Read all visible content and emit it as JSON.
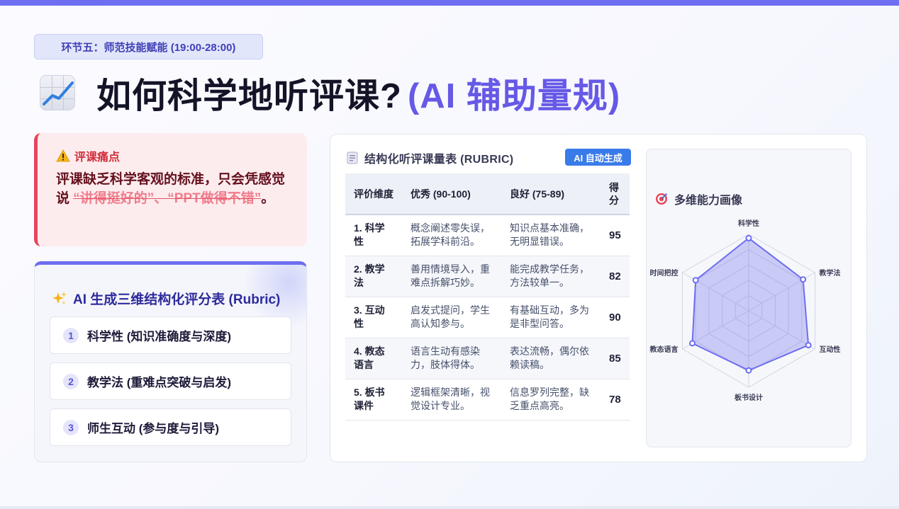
{
  "section_tag": "环节五：师范技能赋能 (19:00-28:00)",
  "title": {
    "main": "如何科学地听评课?",
    "accent": "(AI 辅助量规)",
    "icon": "chart-increasing-icon"
  },
  "pain_point": {
    "heading": "评课痛点",
    "body_prefix": "评课缺乏科学客观的标准，只会凭感觉说",
    "struck_text": "“讲得挺好的”、“PPT做得不错”",
    "body_suffix": "。"
  },
  "rubric_card": {
    "heading": "AI 生成三维结构化评分表 (Rubric)",
    "items": [
      {
        "num": "1",
        "label": "科学性 (知识准确度与深度)"
      },
      {
        "num": "2",
        "label": "教学法 (重难点突破与启发)"
      },
      {
        "num": "3",
        "label": "师生互动 (参与度与引导)"
      }
    ]
  },
  "table": {
    "title": "结构化听评课量表 (RUBRIC)",
    "badge": "AI 自动生成",
    "headers": [
      "评价维度",
      "优秀 (90-100)",
      "良好 (75-89)",
      "得分"
    ],
    "rows": [
      {
        "dim": "1. 科学性",
        "excellent": "概念阐述零失误，拓展学科前沿。",
        "good": "知识点基本准确，无明显错误。",
        "score": "95"
      },
      {
        "dim": "2. 教学法",
        "excellent": "善用情境导入，重难点拆解巧妙。",
        "good": "能完成教学任务，方法较单一。",
        "score": "82"
      },
      {
        "dim": "3. 互动性",
        "excellent": "启发式提问，学生高认知参与。",
        "good": "有基础互动，多为是非型问答。",
        "score": "90"
      },
      {
        "dim": "4. 教态语言",
        "excellent": "语言生动有感染力，肢体得体。",
        "good": "表达流畅，偶尔依赖读稿。",
        "score": "85"
      },
      {
        "dim": "5. 板书课件",
        "excellent": "逻辑框架清晰，视觉设计专业。",
        "good": "信息罗列完整，缺乏重点高亮。",
        "score": "78"
      }
    ]
  },
  "radar": {
    "title": "多维能力画像",
    "accent_color": "#6d6ef0"
  },
  "chart_data": {
    "type": "radar",
    "title": "多维能力画像",
    "axes": [
      "科学性",
      "教学法",
      "互动性",
      "板书设计",
      "教态语言",
      "时间把控"
    ],
    "values": [
      95,
      82,
      90,
      78,
      85,
      80
    ],
    "rmax": 100
  }
}
